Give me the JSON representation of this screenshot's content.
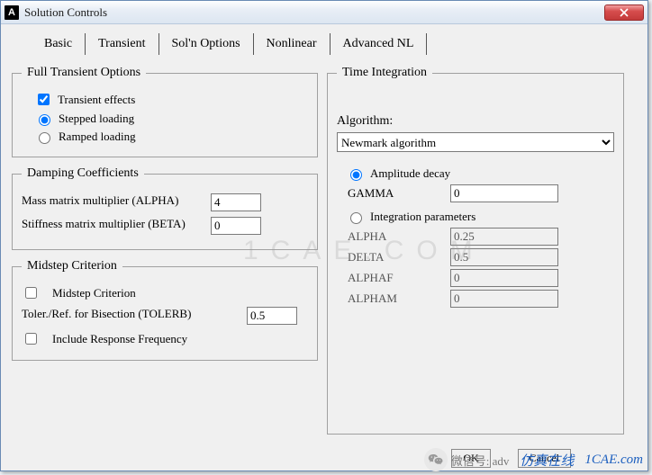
{
  "window": {
    "title": "Solution Controls"
  },
  "tabs": {
    "items": [
      {
        "label": "Basic"
      },
      {
        "label": "Transient"
      },
      {
        "label": "Sol'n Options"
      },
      {
        "label": "Nonlinear"
      },
      {
        "label": "Advanced NL"
      }
    ],
    "selected": 1
  },
  "full_transient": {
    "legend": "Full Transient Options",
    "transient_effects": {
      "label": "Transient effects",
      "checked": true
    },
    "stepped_loading": {
      "label": "Stepped loading",
      "selected": true
    },
    "ramped_loading": {
      "label": "Ramped loading",
      "selected": false
    }
  },
  "damping": {
    "legend": "Damping Coefficients",
    "alpha": {
      "label": "Mass matrix multiplier (ALPHA)",
      "value": "4"
    },
    "beta": {
      "label": "Stiffness matrix multiplier (BETA)",
      "value": "0"
    }
  },
  "midstep": {
    "legend": "Midstep Criterion",
    "criterion": {
      "label": "Midstep Criterion",
      "checked": false
    },
    "tolerb": {
      "label": "Toler./Ref. for Bisection (TOLERB)",
      "value": "0.5"
    },
    "include_resp_freq": {
      "label": "Include Response Frequency",
      "checked": false
    }
  },
  "time_integration": {
    "legend": "Time Integration",
    "algorithm_label": "Algorithm:",
    "algorithm_value": "Newmark algorithm",
    "amp_decay": {
      "label": "Amplitude decay",
      "selected": true
    },
    "int_params": {
      "label": "Integration parameters",
      "selected": false
    },
    "gamma": {
      "label": "GAMMA",
      "value": "0"
    },
    "alpha": {
      "label": "ALPHA",
      "value": "0.25"
    },
    "delta": {
      "label": "DELTA",
      "value": "0.5"
    },
    "alphaf": {
      "label": "ALPHAF",
      "value": "0"
    },
    "alpham": {
      "label": "ALPHAM",
      "value": "0"
    }
  },
  "buttons": {
    "ok": "OK",
    "cancel": "Cancel"
  },
  "watermark": {
    "cae": "1CAE.COM",
    "wechat_prefix": "微信号: adv",
    "brand": "仿真在线",
    "brand2": "1CAE.com"
  }
}
